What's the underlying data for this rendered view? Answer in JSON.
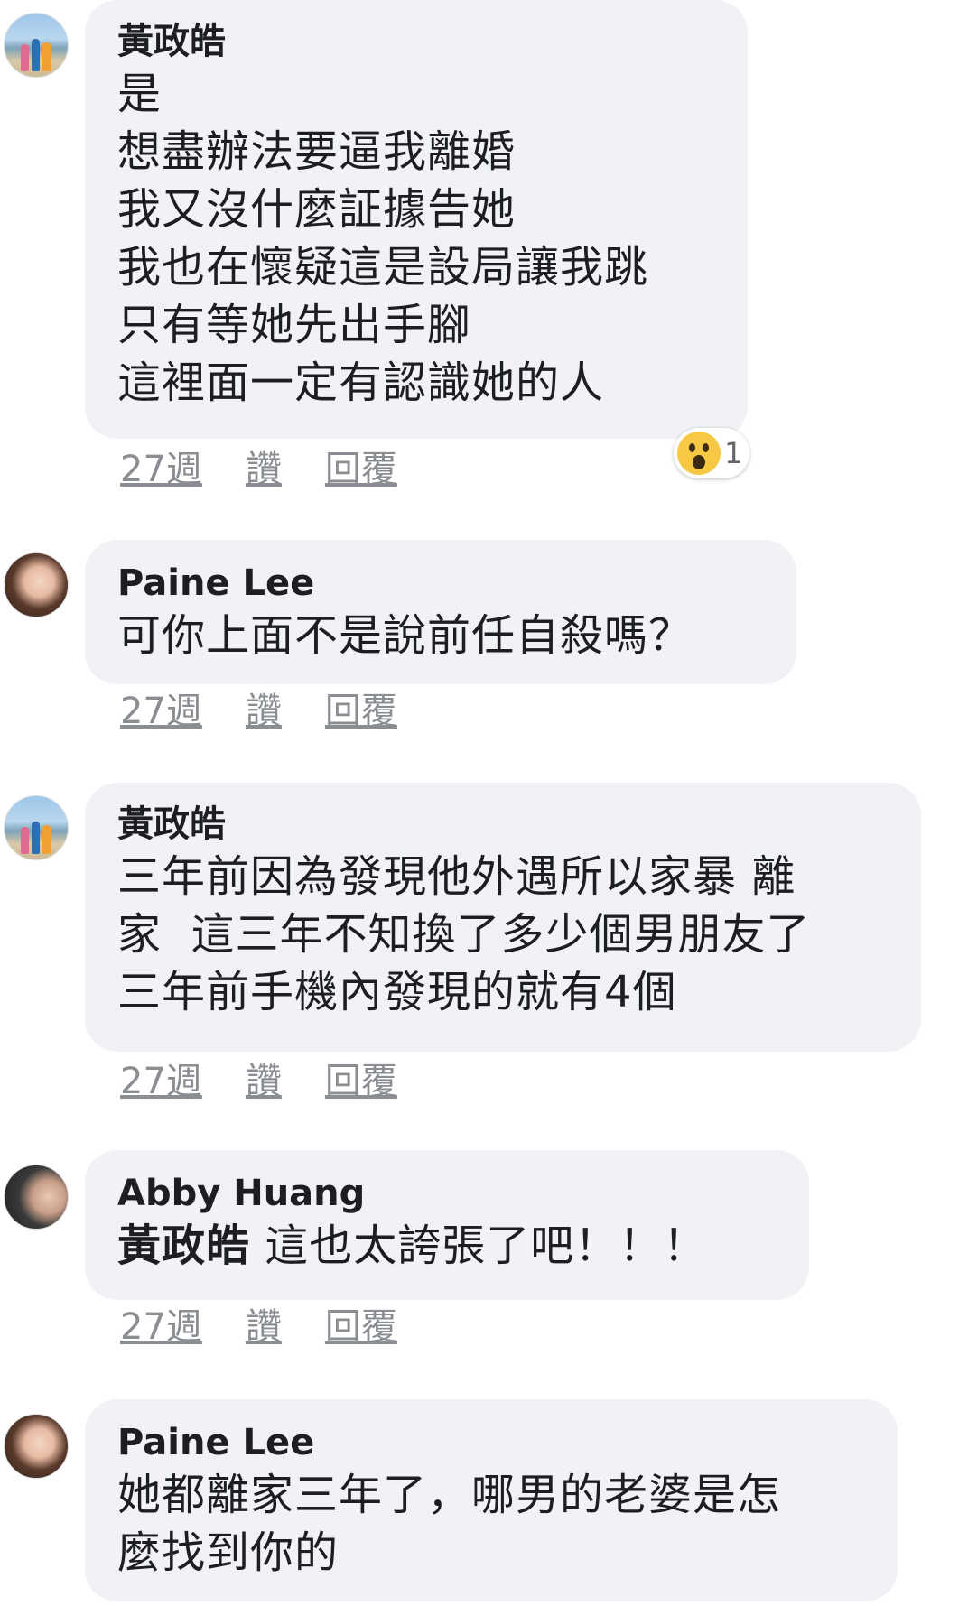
{
  "comments": [
    {
      "author": "黃政皓",
      "lines": [
        "是",
        "想盡辦法要逼我離婚",
        "我又沒什麼証據告她",
        "我也在懷疑這是設局讓我跳",
        "只有等她先出手腳",
        "這裡面一定有認識她的人"
      ],
      "time": "27週",
      "like": "讚",
      "reply": "回覆",
      "reaction": {
        "icon": "wow-emoji-icon",
        "count": "1"
      }
    },
    {
      "author": "Paine Lee",
      "lines": [
        "可你上面不是說前任自殺嗎？"
      ],
      "time": "27週",
      "like": "讚",
      "reply": "回覆"
    },
    {
      "author": "黃政皓",
      "lines": [
        "三年前因為發現他外遇所以家暴 離",
        "家  這三年不知換了多少個男朋友了",
        "三年前手機內發現的就有4個"
      ],
      "time": "27週",
      "like": "讚",
      "reply": "回覆"
    },
    {
      "author": "Abby Huang",
      "mention": "黃政皓",
      "lines": [
        " 這也太誇張了吧！！！"
      ],
      "time": "27週",
      "like": "讚",
      "reply": "回覆"
    },
    {
      "author": "Paine Lee",
      "lines": [
        "她都離家三年了，哪男的老婆是怎",
        "麼找到你的"
      ]
    }
  ],
  "colors": {
    "bubble": "#f0f2f5",
    "meta_text": "#8a8d91",
    "text": "#1c1e21"
  }
}
